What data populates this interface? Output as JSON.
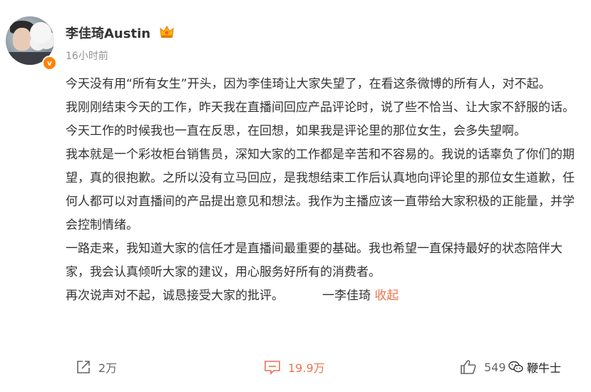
{
  "post": {
    "author": {
      "name": "李佳琦Austin",
      "verified_badge": "v"
    },
    "timestamp": "16小时前",
    "paragraphs": [
      "今天没有用“所有女生”开头，因为李佳琦让大家失望了，在看这条微博的所有人，对不起。",
      "我刚刚结束今天的工作，昨天我在直播间回应产品评论时，说了些不恰当、让大家不舒服的话。今天工作的时候我也一直在反思，在回想，如果我是评论里的那位女生，会多失望啊。",
      "我本就是一个彩妆柜台销售员，深知大家的工作都是辛苦和不容易的。我说的话辜负了你们的期望，真的很抱歉。之所以没有立马回应，是我想结束工作后认真地向评论里的那位女生道歉，任何人都可以对直播间的产品提出意见和想法。我作为主播应该一直带给大家积极的正能量，并学会控制情绪。",
      "一路走来，我知道大家的信任才是直播间最重要的基础。我也希望一直保持最好的状态陪伴大家，我会认真倾听大家的建议，用心服务好所有的消费者。"
    ],
    "last_line": "再次说声对不起，诚恳接受大家的批评。",
    "signature": "一李佳琦",
    "collapse_label": "收起"
  },
  "actions": {
    "repost_count": "2万",
    "comment_count": "19.9万",
    "like_count": "549"
  },
  "watermark": {
    "text": "鞭牛士"
  },
  "colors": {
    "accent": "#eb7350",
    "verified": "#ff8200",
    "text": "#333333",
    "muted": "#939393"
  },
  "icons": {
    "repost": "repost-icon",
    "comment": "comment-icon",
    "like": "like-icon",
    "crown": "crown-icon",
    "watermark": "wechat-icon"
  }
}
